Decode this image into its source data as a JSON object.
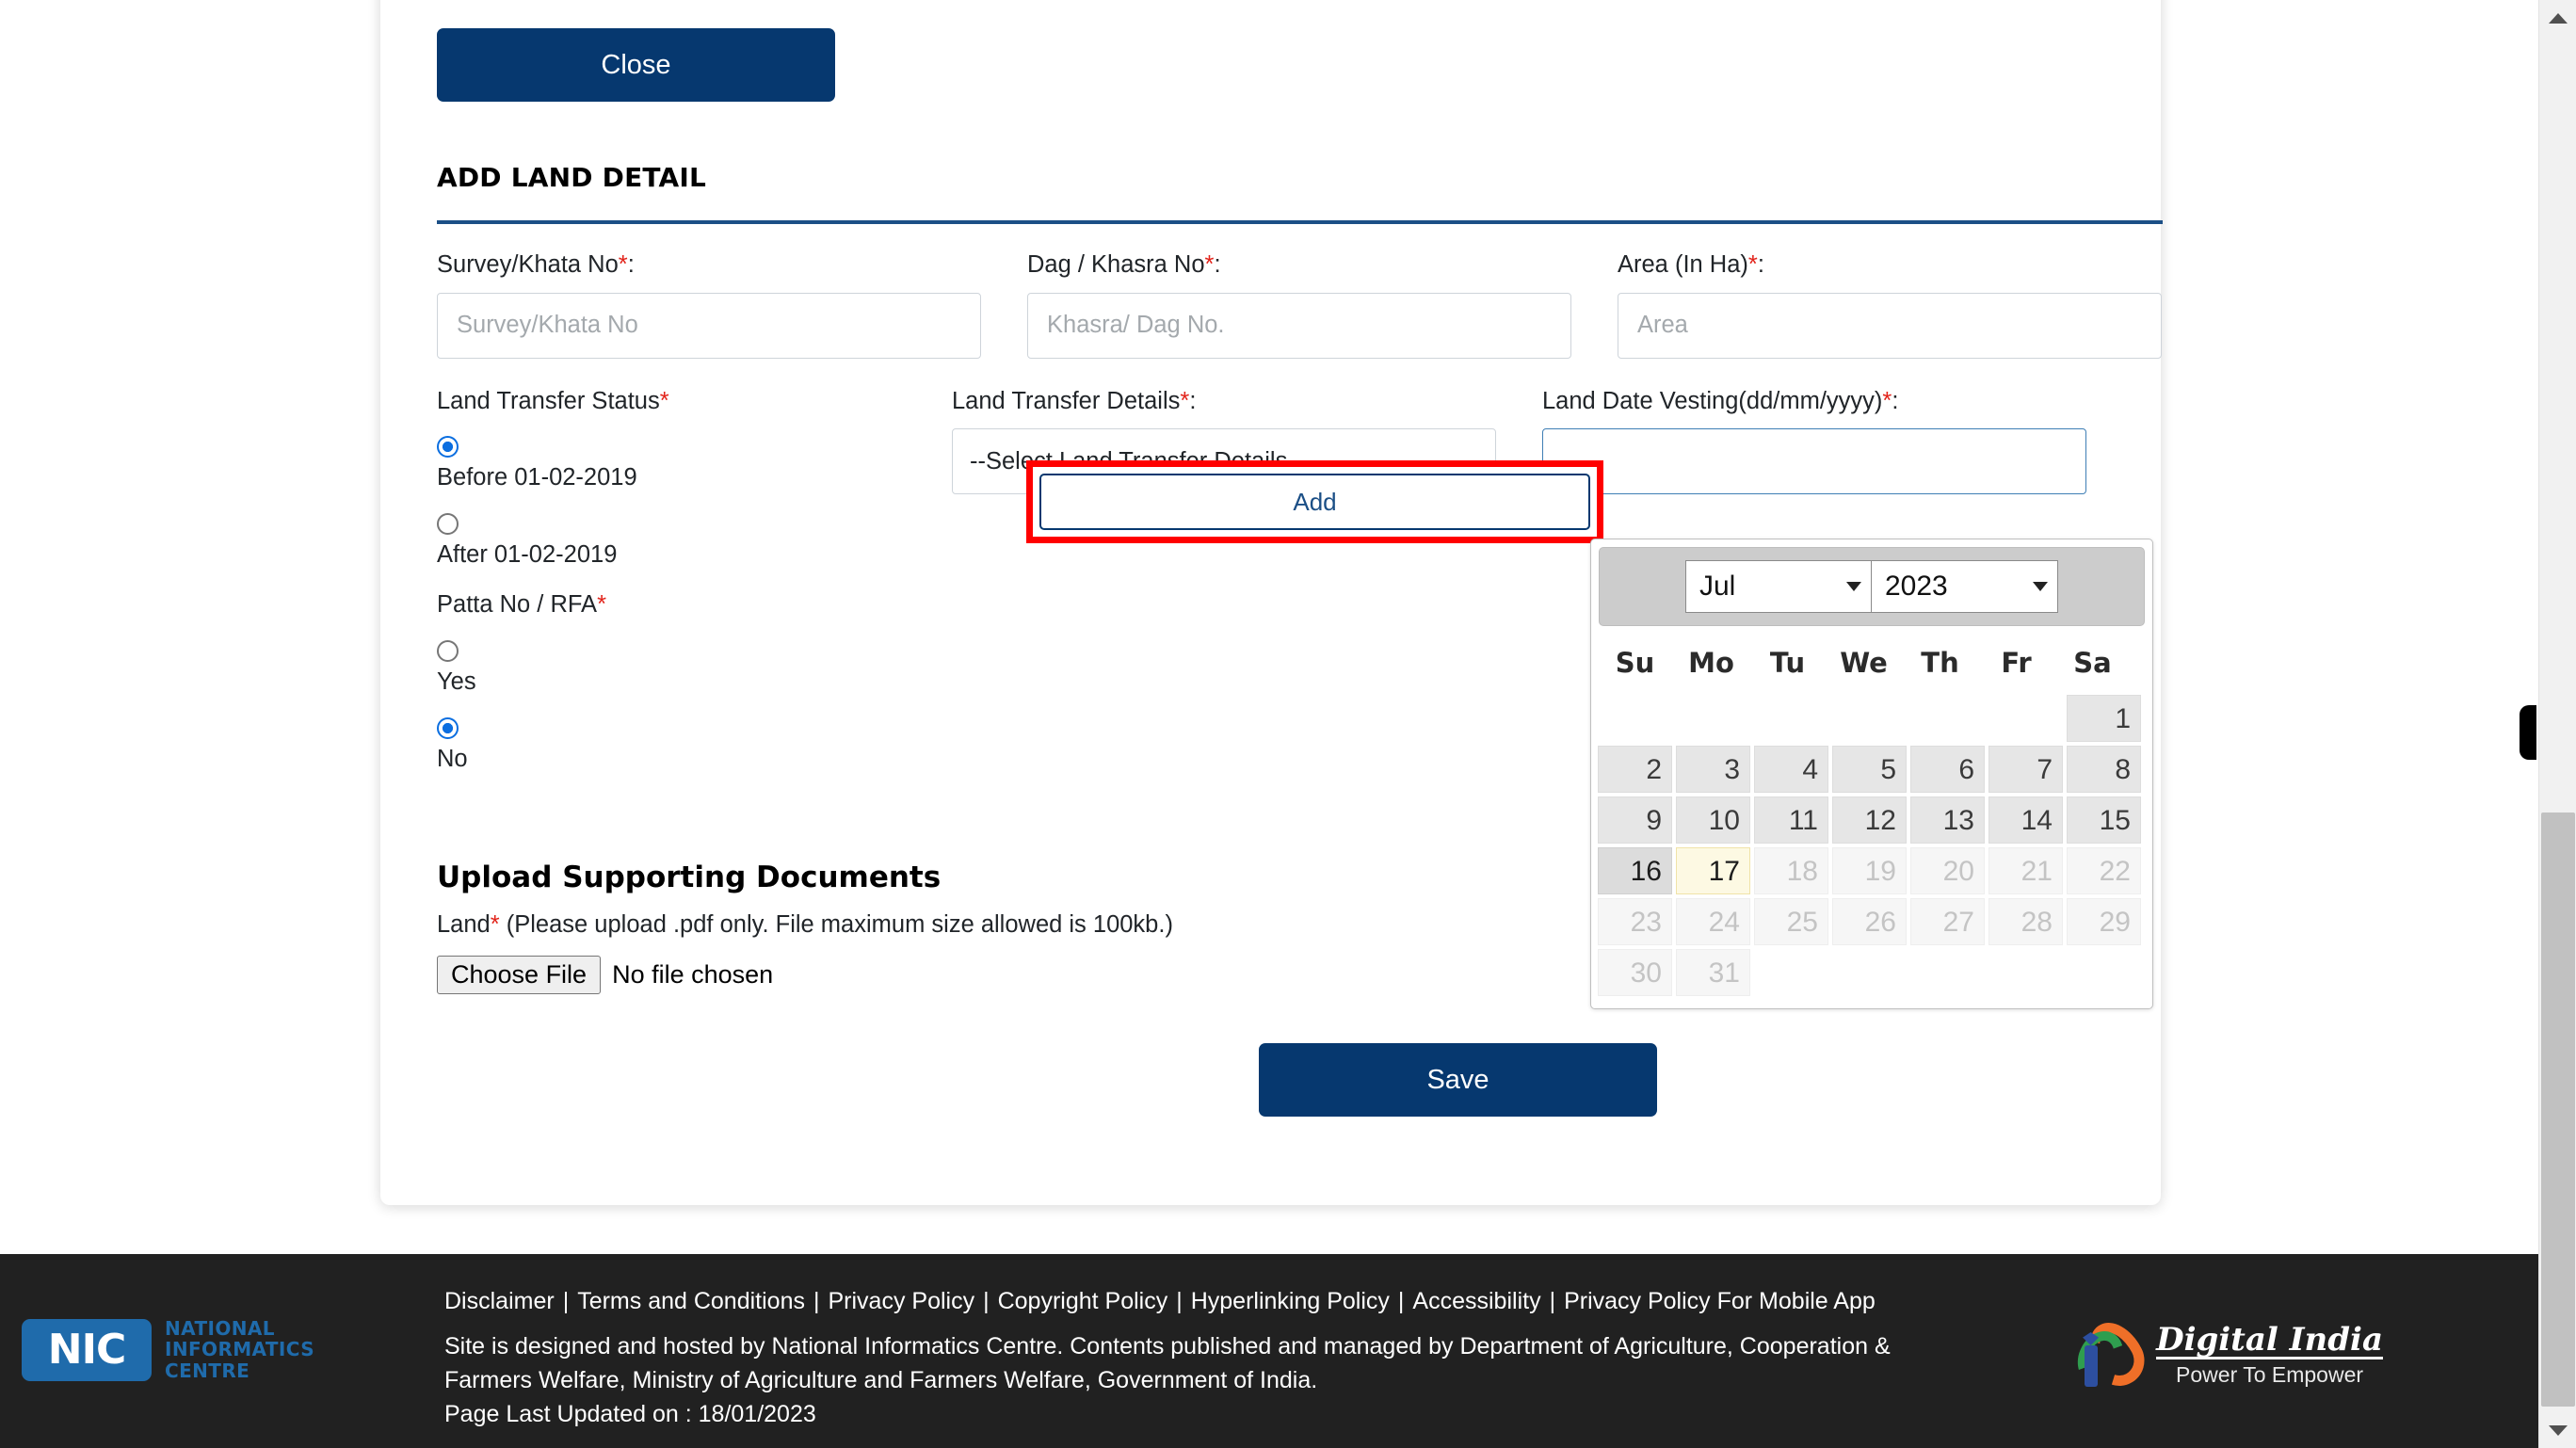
{
  "card": {
    "close_label": "Close",
    "section_title": "ADD LAND DETAIL"
  },
  "form": {
    "survey": {
      "label": "Survey/Khata No",
      "required_mark": "*",
      "colon": ":",
      "placeholder": "Survey/Khata No",
      "value": ""
    },
    "dag": {
      "label": "Dag / Khasra No",
      "required_mark": "*",
      "colon": ":",
      "placeholder": "Khasra/ Dag No.",
      "value": ""
    },
    "area": {
      "label": "Area (In Ha)",
      "required_mark": "*",
      "colon": ":",
      "placeholder": "Area",
      "value": ""
    },
    "land_transfer_status": {
      "label": "Land Transfer Status",
      "required_mark": "*",
      "options": [
        {
          "text": "Before 01-02-2019",
          "checked": true
        },
        {
          "text": "After 01-02-2019",
          "checked": false
        }
      ]
    },
    "land_transfer_details": {
      "label": "Land Transfer Details",
      "required_mark": "*",
      "colon": ":",
      "selected": "--Select Land Transfer Details--"
    },
    "land_date_vesting": {
      "label": "Land Date Vesting(dd/mm/yyyy)",
      "required_mark": "*",
      "colon": ":",
      "value": ""
    },
    "patta": {
      "label": "Patta No / RFA",
      "required_mark": "*",
      "options": [
        {
          "text": "Yes",
          "checked": false
        },
        {
          "text": "No",
          "checked": true
        }
      ]
    },
    "add_button_label": "Add"
  },
  "datepicker": {
    "month": "Jul",
    "year": "2023",
    "dow": [
      "Su",
      "Mo",
      "Tu",
      "We",
      "Th",
      "Fr",
      "Sa"
    ],
    "weeks": [
      [
        {
          "d": "",
          "state": "blank"
        },
        {
          "d": "",
          "state": "blank"
        },
        {
          "d": "",
          "state": "blank"
        },
        {
          "d": "",
          "state": "blank"
        },
        {
          "d": "",
          "state": "blank"
        },
        {
          "d": "",
          "state": "blank"
        },
        {
          "d": "1",
          "state": "enabled"
        }
      ],
      [
        {
          "d": "2",
          "state": "enabled"
        },
        {
          "d": "3",
          "state": "enabled"
        },
        {
          "d": "4",
          "state": "enabled"
        },
        {
          "d": "5",
          "state": "enabled"
        },
        {
          "d": "6",
          "state": "enabled"
        },
        {
          "d": "7",
          "state": "enabled"
        },
        {
          "d": "8",
          "state": "enabled"
        }
      ],
      [
        {
          "d": "9",
          "state": "enabled"
        },
        {
          "d": "10",
          "state": "enabled"
        },
        {
          "d": "11",
          "state": "enabled"
        },
        {
          "d": "12",
          "state": "enabled"
        },
        {
          "d": "13",
          "state": "enabled"
        },
        {
          "d": "14",
          "state": "enabled"
        },
        {
          "d": "15",
          "state": "enabled"
        }
      ],
      [
        {
          "d": "16",
          "state": "hover"
        },
        {
          "d": "17",
          "state": "today"
        },
        {
          "d": "18",
          "state": "disabled"
        },
        {
          "d": "19",
          "state": "disabled"
        },
        {
          "d": "20",
          "state": "disabled"
        },
        {
          "d": "21",
          "state": "disabled"
        },
        {
          "d": "22",
          "state": "disabled"
        }
      ],
      [
        {
          "d": "23",
          "state": "disabled"
        },
        {
          "d": "24",
          "state": "disabled"
        },
        {
          "d": "25",
          "state": "disabled"
        },
        {
          "d": "26",
          "state": "disabled"
        },
        {
          "d": "27",
          "state": "disabled"
        },
        {
          "d": "28",
          "state": "disabled"
        },
        {
          "d": "29",
          "state": "disabled"
        }
      ],
      [
        {
          "d": "30",
          "state": "disabled"
        },
        {
          "d": "31",
          "state": "disabled"
        },
        {
          "d": "",
          "state": "blank"
        },
        {
          "d": "",
          "state": "blank"
        },
        {
          "d": "",
          "state": "blank"
        },
        {
          "d": "",
          "state": "blank"
        },
        {
          "d": "",
          "state": "blank"
        }
      ]
    ]
  },
  "upload": {
    "heading": "Upload Supporting Documents",
    "note_label": "Land",
    "required_mark": "*",
    "note_text": " (Please upload .pdf only. File maximum size allowed is 100kb.)",
    "choose_file_label": "Choose File",
    "file_status": "No file chosen"
  },
  "save_label": "Save",
  "footer": {
    "links": [
      "Disclaimer",
      "Terms and Conditions",
      "Privacy Policy",
      "Copyright Policy",
      "Hyperlinking Policy",
      "Accessibility",
      "Privacy Policy For Mobile App"
    ],
    "separator": "|",
    "line1": "Site is designed and hosted by National Informatics Centre. Contents published and managed by Department of Agriculture, Cooperation &",
    "line2": "Farmers Welfare, Ministry of Agriculture and Farmers Welfare, Government of India.",
    "line3": "Page Last Updated on : 18/01/2023",
    "nic": {
      "mark": "NIC",
      "line1": "NATIONAL",
      "line2": "INFORMATICS",
      "line3": "CENTRE"
    },
    "digital_india": {
      "title": "Digital India",
      "tagline": "Power To Empower"
    }
  },
  "colors": {
    "primary": "#06386f",
    "accent_rule": "#1b4f86",
    "highlight": "#ff0000",
    "required": "#e2231a",
    "footer_bg": "#212121",
    "nic_blue": "#1f6bab"
  }
}
